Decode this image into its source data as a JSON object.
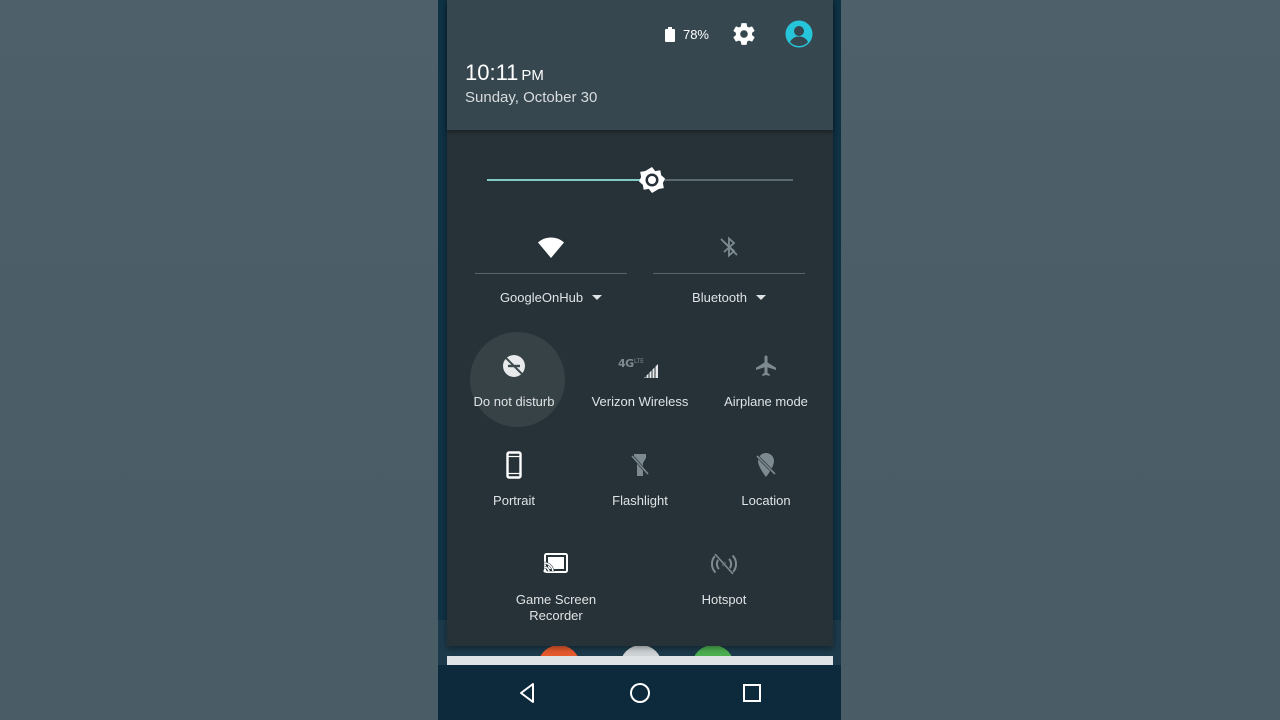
{
  "status": {
    "battery_percent": "78%",
    "battery_icon": "battery-icon",
    "settings_icon": "gear-icon",
    "account_icon": "account-icon"
  },
  "header": {
    "time": "10:11",
    "ampm": "PM",
    "date": "Sunday, October 30"
  },
  "brightness": {
    "level": 0.54,
    "icon": "brightness-icon"
  },
  "big_tiles": [
    {
      "label": "GoogleOnHub",
      "icon": "wifi-icon",
      "has_dropdown": true
    },
    {
      "label": "Bluetooth",
      "icon": "bluetooth-off-icon",
      "has_dropdown": true
    }
  ],
  "tiles": [
    {
      "label": "Do not disturb",
      "icon": "do-not-disturb-icon"
    },
    {
      "label": "Verizon Wireless",
      "icon": "cellular-4g-icon",
      "badge": "4G LTE"
    },
    {
      "label": "Airplane mode",
      "icon": "airplane-icon"
    },
    {
      "label": "Portrait",
      "icon": "phone-portrait-icon"
    },
    {
      "label": "Flashlight",
      "icon": "flashlight-off-icon"
    },
    {
      "label": "Location",
      "icon": "location-off-icon"
    },
    {
      "label_line1": "Game Screen",
      "label_line2": "Recorder",
      "icon": "cast-icon"
    },
    {
      "label": "Hotspot",
      "icon": "hotspot-off-icon"
    }
  ],
  "colors": {
    "shade_bg": "#263238",
    "header_bg": "#37474f",
    "accent": "#80cbc4",
    "account": "#26c6da"
  },
  "navbar": {
    "back_icon": "back-triangle-icon",
    "home_icon": "home-circle-icon",
    "recents_icon": "recents-square-icon"
  }
}
